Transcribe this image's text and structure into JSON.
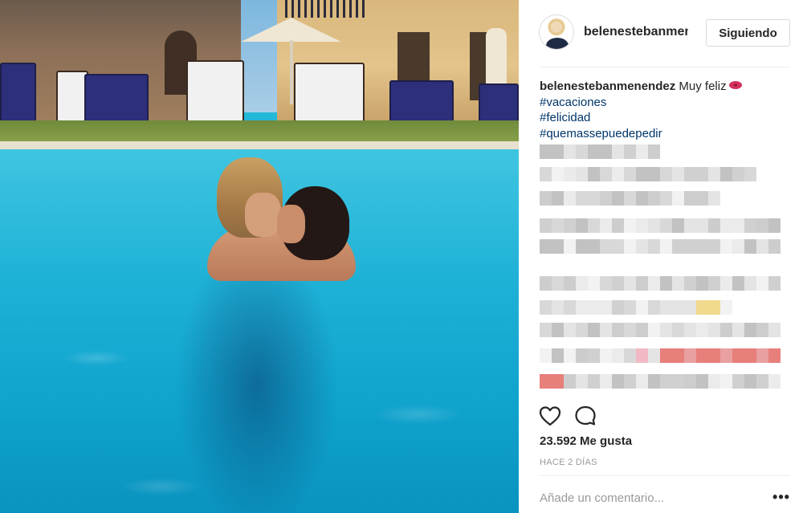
{
  "post": {
    "username": "belenestebanmenendez",
    "header_username_display": "belenestebanmenendez",
    "follow_button": "Siguiendo",
    "caption_text": "Muy feliz",
    "hashtags": [
      "#vacaciones",
      "#felicidad",
      "#quemassepuedepedir"
    ],
    "likes": "23.592 Me gusta",
    "time_ago": "HACE 2 DÍAS",
    "comment_placeholder": "Añade un comentario...",
    "more_label": "•••"
  },
  "icons": {
    "avatar": "profile-avatar",
    "caption_emoji": "kiss-lips-icon",
    "like": "heart-icon",
    "comment": "comment-bubble-icon",
    "more": "more-options-icon"
  },
  "colors": {
    "hashtag": "#003569",
    "muted": "#999999",
    "text": "#262626",
    "border": "#dbdbdb"
  }
}
